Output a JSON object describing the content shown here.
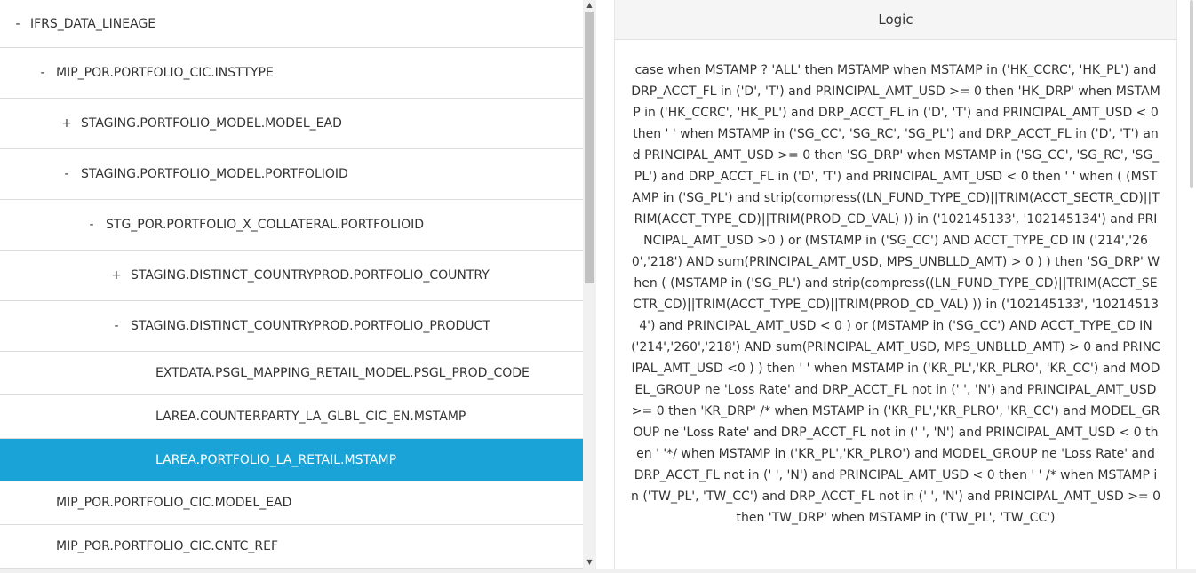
{
  "tree": {
    "rows": [
      {
        "toggle": "-",
        "label": "IFRS_DATA_LINEAGE"
      },
      {
        "toggle": "-",
        "label": "MIP_POR.PORTFOLIO_CIC.INSTTYPE"
      },
      {
        "toggle": "+",
        "label": "STAGING.PORTFOLIO_MODEL.MODEL_EAD"
      },
      {
        "toggle": "-",
        "label": "STAGING.PORTFOLIO_MODEL.PORTFOLIOID"
      },
      {
        "toggle": "-",
        "label": "STG_POR.PORTFOLIO_X_COLLATERAL.PORTFOLIOID"
      },
      {
        "toggle": "+",
        "label": "STAGING.DISTINCT_COUNTRYPROD.PORTFOLIO_COUNTRY"
      },
      {
        "toggle": "-",
        "label": "STAGING.DISTINCT_COUNTRYPROD.PORTFOLIO_PRODUCT"
      },
      {
        "toggle": "",
        "label": "EXTDATA.PSGL_MAPPING_RETAIL_MODEL.PSGL_PROD_CODE"
      },
      {
        "toggle": "",
        "label": "LAREA.COUNTERPARTY_LA_GLBL_CIC_EN.MSTAMP"
      },
      {
        "toggle": "",
        "label": "LAREA.PORTFOLIO_LA_RETAIL.MSTAMP",
        "selected": true
      },
      {
        "toggle": "",
        "label": "MIP_POR.PORTFOLIO_CIC.MODEL_EAD"
      },
      {
        "toggle": "",
        "label": "MIP_POR.PORTFOLIO_CIC.CNTC_REF"
      }
    ]
  },
  "logic": {
    "title": "Logic",
    "text": "case when MSTAMP ? 'ALL' then MSTAMP when MSTAMP in ('HK_CCRC', 'HK_PL') and DRP_ACCT_FL in ('D', 'T') and PRINCIPAL_AMT_USD >= 0 then 'HK_DRP' when MSTAMP in ('HK_CCRC', 'HK_PL') and DRP_ACCT_FL in ('D', 'T') and PRINCIPAL_AMT_USD < 0 then ' ' when MSTAMP in ('SG_CC', 'SG_RC', 'SG_PL') and DRP_ACCT_FL in ('D', 'T') and PRINCIPAL_AMT_USD >= 0 then 'SG_DRP' when MSTAMP in ('SG_CC', 'SG_RC', 'SG_PL') and DRP_ACCT_FL in ('D', 'T') and PRINCIPAL_AMT_USD < 0 then ' ' when ( (MSTAMP in ('SG_PL') and strip(compress((LN_FUND_TYPE_CD)||TRIM(ACCT_SECTR_CD)||TRIM(ACCT_TYPE_CD)||TRIM(PROD_CD_VAL) )) in ('102145133', '102145134') and PRINCIPAL_AMT_USD >0 ) or (MSTAMP in ('SG_CC') AND ACCT_TYPE_CD IN ('214','260','218') AND sum(PRINCIPAL_AMT_USD, MPS_UNBLLD_AMT) > 0 ) ) then 'SG_DRP' When ( (MSTAMP in ('SG_PL') and strip(compress((LN_FUND_TYPE_CD)||TRIM(ACCT_SECTR_CD)||TRIM(ACCT_TYPE_CD)||TRIM(PROD_CD_VAL) )) in ('102145133', '102145134') and PRINCIPAL_AMT_USD < 0 ) or (MSTAMP in ('SG_CC') AND ACCT_TYPE_CD IN ('214','260','218') AND sum(PRINCIPAL_AMT_USD, MPS_UNBLLD_AMT) > 0 and PRINCIPAL_AMT_USD <0 ) ) then ' ' when MSTAMP in ('KR_PL','KR_PLRO', 'KR_CC') and MODEL_GROUP ne 'Loss Rate' and DRP_ACCT_FL not in (' ', 'N') and PRINCIPAL_AMT_USD >= 0 then 'KR_DRP' /* when MSTAMP in ('KR_PL','KR_PLRO', 'KR_CC') and MODEL_GROUP ne 'Loss Rate' and DRP_ACCT_FL not in (' ', 'N') and PRINCIPAL_AMT_USD < 0 then ' '*/ when MSTAMP in ('KR_PL','KR_PLRO') and MODEL_GROUP ne 'Loss Rate' and DRP_ACCT_FL not in (' ', 'N') and PRINCIPAL_AMT_USD < 0 then ' ' /* when MSTAMP in ('TW_PL', 'TW_CC') and DRP_ACCT_FL not in (' ', 'N') and PRINCIPAL_AMT_USD >= 0 then 'TW_DRP' when MSTAMP in ('TW_PL', 'TW_CC')"
  },
  "colors": {
    "selected_row": "#1aa3d6",
    "header_bg": "#f5f5f5"
  }
}
